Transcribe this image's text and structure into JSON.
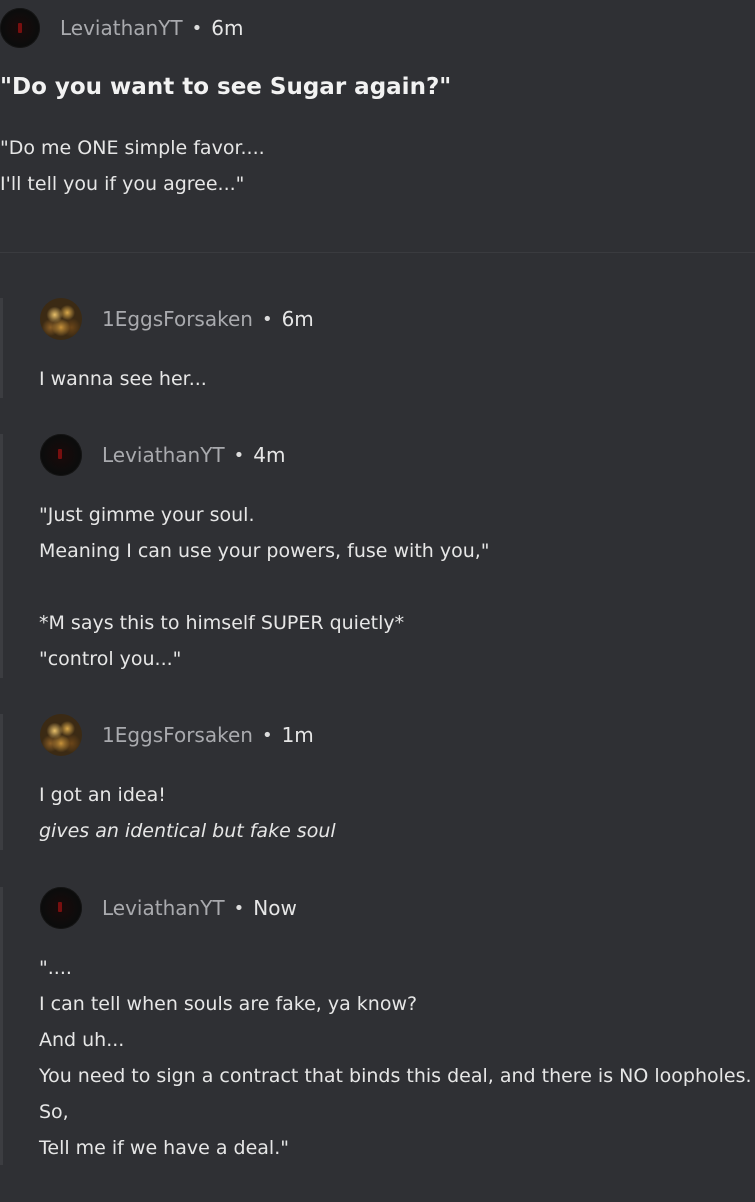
{
  "post": {
    "author": "LeviathanYT",
    "time": "6m",
    "separator": "•",
    "title": "\"Do you want to see Sugar again?\"",
    "body": [
      "\"Do me ONE simple favor....",
      "I'll tell you if you agree...\""
    ]
  },
  "replies": [
    {
      "author": "1EggsForsaken",
      "time": "6m",
      "avatar_icon": "gold-collage-avatar",
      "lines": [
        "I wanna see her..."
      ]
    },
    {
      "author": "LeviathanYT",
      "time": "4m",
      "avatar_icon": "dark-red-avatar",
      "lines": [
        "\"Just gimme your soul.",
        "Meaning I can use your powers, fuse with you,\"",
        "",
        "*M says this to himself SUPER quietly*",
        "\"control you...\""
      ]
    },
    {
      "author": "1EggsForsaken",
      "time": "1m",
      "avatar_icon": "gold-collage-avatar",
      "lines": [
        "I got an idea!",
        "gives an identical but fake soul"
      ]
    },
    {
      "author": "LeviathanYT",
      "time": "Now",
      "avatar_icon": "dark-red-avatar",
      "lines": [
        "\"....",
        "I can tell when souls are fake, ya know?",
        "And uh...",
        "You need to sign a contract that binds this deal, and there is NO loopholes.",
        "So,",
        "Tell me if we have a deal.\""
      ]
    }
  ],
  "colors": {
    "background": "#2f3034",
    "username": "#a9aaae",
    "text": "#e6e6e6"
  }
}
